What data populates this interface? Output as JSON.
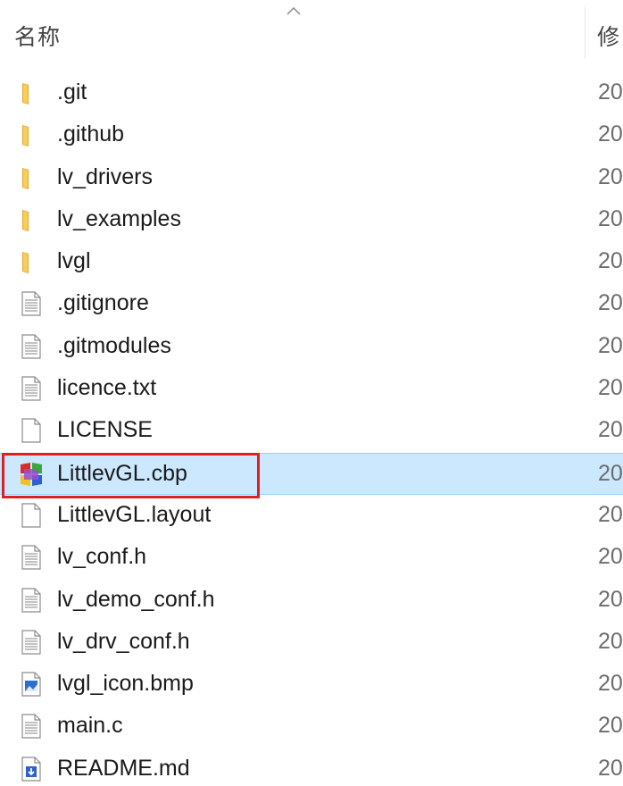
{
  "header": {
    "name_label": "名称",
    "date_label": "修"
  },
  "files": [
    {
      "name": ".git",
      "type": "folder",
      "date": "20",
      "icon": "folder-icon"
    },
    {
      "name": ".github",
      "type": "folder",
      "date": "20",
      "icon": "folder-icon"
    },
    {
      "name": "lv_drivers",
      "type": "folder",
      "date": "20",
      "icon": "folder-icon"
    },
    {
      "name": "lv_examples",
      "type": "folder",
      "date": "20",
      "icon": "folder-icon"
    },
    {
      "name": "lvgl",
      "type": "folder",
      "date": "20",
      "icon": "folder-icon"
    },
    {
      "name": ".gitignore",
      "type": "text",
      "date": "20",
      "icon": "text-file-icon"
    },
    {
      "name": ".gitmodules",
      "type": "text",
      "date": "20",
      "icon": "text-file-icon"
    },
    {
      "name": "licence.txt",
      "type": "text",
      "date": "20",
      "icon": "text-file-icon"
    },
    {
      "name": "LICENSE",
      "type": "blank",
      "date": "20",
      "icon": "blank-file-icon"
    },
    {
      "name": "LittlevGL.cbp",
      "type": "codeblocks",
      "date": "20",
      "icon": "codeblocks-project-icon",
      "selected": true
    },
    {
      "name": "LittlevGL.layout",
      "type": "blank",
      "date": "20",
      "icon": "blank-file-icon"
    },
    {
      "name": "lv_conf.h",
      "type": "text",
      "date": "20",
      "icon": "text-file-icon"
    },
    {
      "name": "lv_demo_conf.h",
      "type": "text",
      "date": "20",
      "icon": "text-file-icon"
    },
    {
      "name": "lv_drv_conf.h",
      "type": "text",
      "date": "20",
      "icon": "text-file-icon"
    },
    {
      "name": "lvgl_icon.bmp",
      "type": "image",
      "date": "20",
      "icon": "image-file-icon"
    },
    {
      "name": "main.c",
      "type": "text",
      "date": "20",
      "icon": "text-file-icon"
    },
    {
      "name": "README.md",
      "type": "markdown",
      "date": "20",
      "icon": "markdown-file-icon"
    }
  ],
  "colors": {
    "selection_bg": "#cce8ff",
    "selection_border": "#99d1ff",
    "highlight_box": "#e02020",
    "folder": "#f4c84a"
  }
}
